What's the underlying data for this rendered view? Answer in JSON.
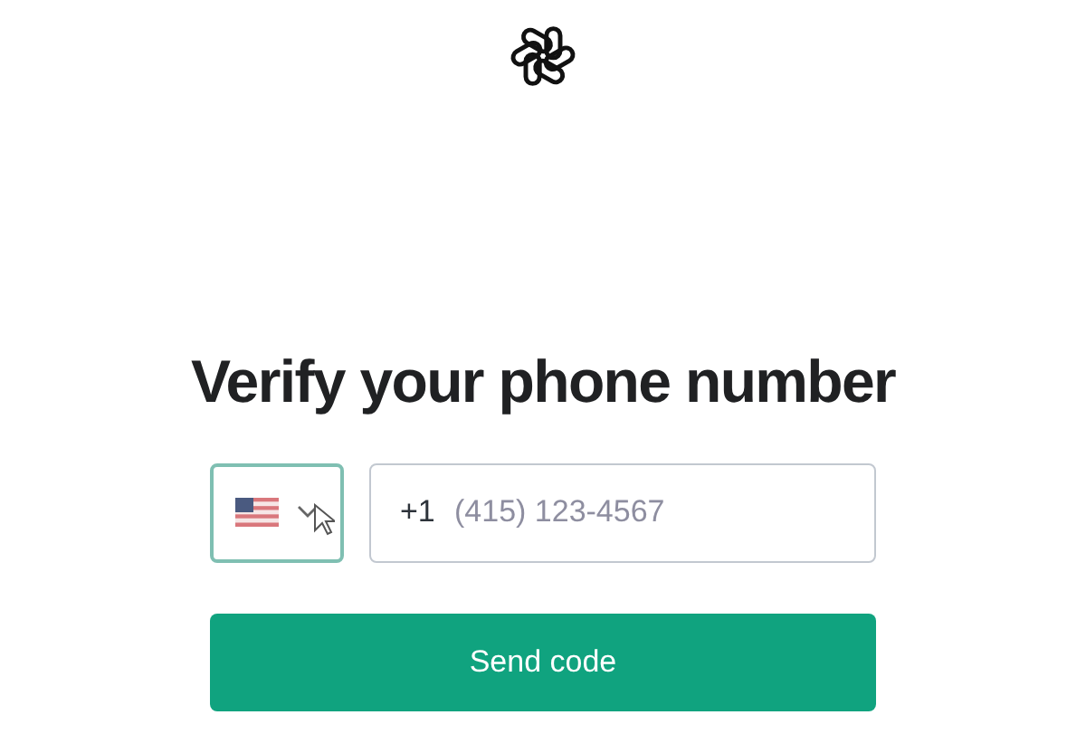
{
  "heading": "Verify your phone number",
  "country_select": {
    "focused": true
  },
  "phone_field": {
    "prefix": "+1",
    "placeholder": "(415) 123-4567"
  },
  "submit_button": {
    "label": "Send code"
  }
}
